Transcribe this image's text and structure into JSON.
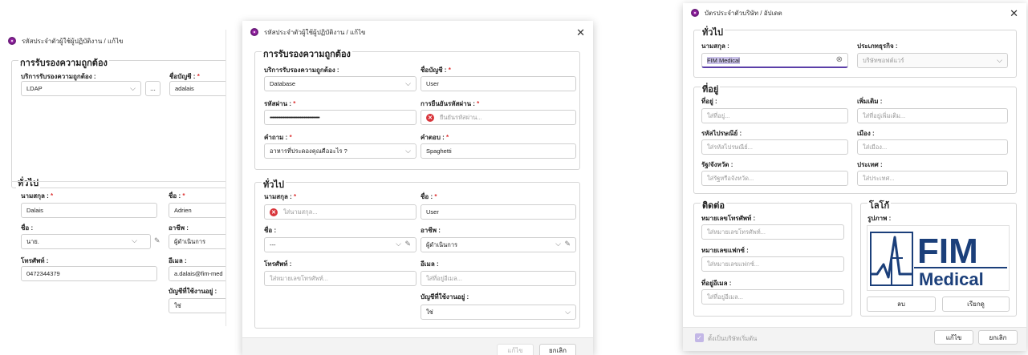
{
  "win1": {
    "title": "รหัสประจำตัวผู้ใช้ผู้ปฏิบัติงาน / แก้ไข",
    "auth_legend": "การรับรองความถูกต้อง",
    "auth_service_label": "บริการรับรองความถูกต้อง :",
    "auth_service_value": "LDAP",
    "ellipsis": "...",
    "account_label": "ชื่อบัญชี :",
    "account_value": "adalais",
    "general_legend": "ทั่วไป",
    "lastname_label": "นามสกุล :",
    "lastname_value": "Dalais",
    "firstname_label": "ชื่อ :",
    "firstname_value": "Adrien",
    "title_label": "ชื่อ :",
    "title_value": "นาย.",
    "job_label": "อาชีพ :",
    "job_value": "ผู้ดำเนินการ",
    "phone_label": "โทรศัพท์ :",
    "phone_value": "0472344379",
    "email_label": "อีเมล :",
    "email_value": "a.dalais@fim-med",
    "active_label": "บัญชีที่ใช้งานอยู่ :",
    "active_value": "ใช่"
  },
  "win2": {
    "title": "รหัสประจำตัวผู้ใช้ผู้ปฏิบัติงาน / แก้ไข",
    "auth_legend": "การรับรองความถูกต้อง",
    "auth_service_label": "บริการรับรองความถูกต้อง :",
    "auth_service_value": "Database",
    "account_label": "ชื่อบัญชี :",
    "account_value": "User",
    "password_label": "รหัสผ่าน :",
    "password_value": "••••••••••••••••••••••••••••••••••••••",
    "confirm_label": "การยืนยันรหัสผ่าน :",
    "confirm_placeholder": "ยืนยันรหัสผ่าน...",
    "question_label": "คำถาม :",
    "question_value": "อาหารที่ประดองคุณคืออะไร ?",
    "answer_label": "คำตอบ :",
    "answer_value": "Spaghetti",
    "general_legend": "ทั่วไป",
    "lastname_label": "นามสกุล :",
    "lastname_placeholder": "ใส่นามสกุล...",
    "firstname_label": "ชื่อ :",
    "firstname_value": "User",
    "title_label": "ชื่อ :",
    "title_value": "---",
    "job_label": "อาชีพ :",
    "job_value": "ผู้ดำเนินการ",
    "phone_label": "โทรศัพท์ :",
    "phone_placeholder": "ใส่หมายเลขโทรศัพท์...",
    "email_label": "อีเมล :",
    "email_placeholder": "ใส่ที่อยู่อีเมล...",
    "active_label": "บัญชีที่ใช้งานอยู่ :",
    "active_value": "ใช่",
    "edit_button": "แก้ไข",
    "cancel_button": "ยกเลิก"
  },
  "win3": {
    "title": "บัตรประจำตัวบริษัท / อัปเดต",
    "general_legend": "ทั่วไป",
    "lastname_label": "นามสกุล :",
    "lastname_value": "FIM Medical",
    "business_type_label": "ประเภทธุรกิจ :",
    "business_type_placeholder": "บริษัทซอฟต์แวร์",
    "address_legend": "ที่อยู่",
    "address_label": "ที่อยู่ :",
    "address_placeholder": "ใส่ที่อยู่...",
    "extra_label": "เพิ่มเติม :",
    "extra_placeholder": "ใส่ที่อยู่เพิ่มเติม...",
    "postal_label": "รหัสไปรษณีย์ :",
    "postal_placeholder": "ใส่รหัสไปรษณีย์...",
    "city_label": "เมือง :",
    "city_placeholder": "ใส่เมือง...",
    "state_label": "รัฐ/จังหวัด :",
    "state_placeholder": "ใส่รัฐหรือจังหวัด...",
    "country_label": "ประเทศ :",
    "country_placeholder": "ใส่ประเทศ...",
    "contact_legend": "ติดต่อ",
    "phone_label": "หมายเลขโทรศัพท์ :",
    "phone_placeholder": "ใส่หมายเลขโทรศัพท์...",
    "fax_label": "หมายเลขแฟกซ์ :",
    "fax_placeholder": "ใส่หมายเลขแฟกซ์...",
    "email_label": "ที่อยู่อีเมล :",
    "email_placeholder": "ใส่ที่อยู่อีเมล...",
    "logo_legend": "โลโก้",
    "image_label": "รูปภาพ :",
    "logo_text_fim": "FIM",
    "logo_text_medical": "Medical",
    "delete_button": "ลบ",
    "browse_button": "เรียกดู",
    "default_checkbox_label": "ตั้งเป็นบริษัทเริ่มต้น",
    "edit_button": "แก้ไข",
    "cancel_button": "ยกเลิก",
    "accent_color": "#5b3fa8",
    "logo_color": "#1b3f7a"
  }
}
